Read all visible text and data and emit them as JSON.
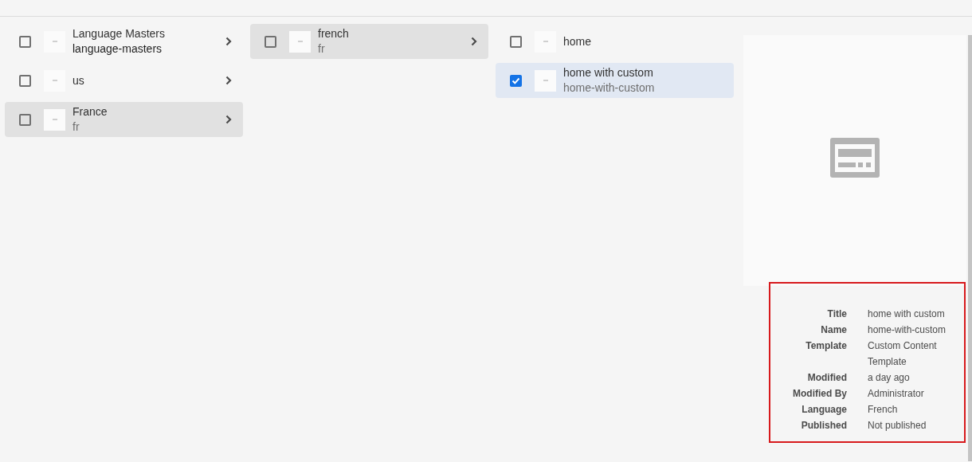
{
  "columns": [
    {
      "items": [
        {
          "title": "Language Masters",
          "name": "language-masters",
          "checked": false,
          "active": false,
          "has_children": true
        },
        {
          "title": "us",
          "checked": false,
          "active": false,
          "has_children": true
        },
        {
          "title": "France",
          "name": "fr",
          "checked": false,
          "active": true,
          "has_children": true
        }
      ]
    },
    {
      "items": [
        {
          "title": "french",
          "name": "fr",
          "checked": false,
          "active": true,
          "has_children": true
        }
      ]
    },
    {
      "items": [
        {
          "title": "home",
          "checked": false,
          "active": false,
          "has_children": false
        },
        {
          "title": "home with custom",
          "name": "home-with-custom",
          "checked": true,
          "active": false,
          "has_children": false
        }
      ]
    }
  ],
  "preview": {
    "properties": [
      {
        "label": "Title",
        "value": "home with custom"
      },
      {
        "label": "Name",
        "value": "home-with-custom"
      },
      {
        "label": "Template",
        "value": "Custom Content Template"
      },
      {
        "label": "Modified",
        "value": "a day ago"
      },
      {
        "label": "Modified By",
        "value": "Administrator"
      },
      {
        "label": "Language",
        "value": "French"
      },
      {
        "label": "Published",
        "value": "Not published"
      }
    ],
    "highlighted": true
  }
}
